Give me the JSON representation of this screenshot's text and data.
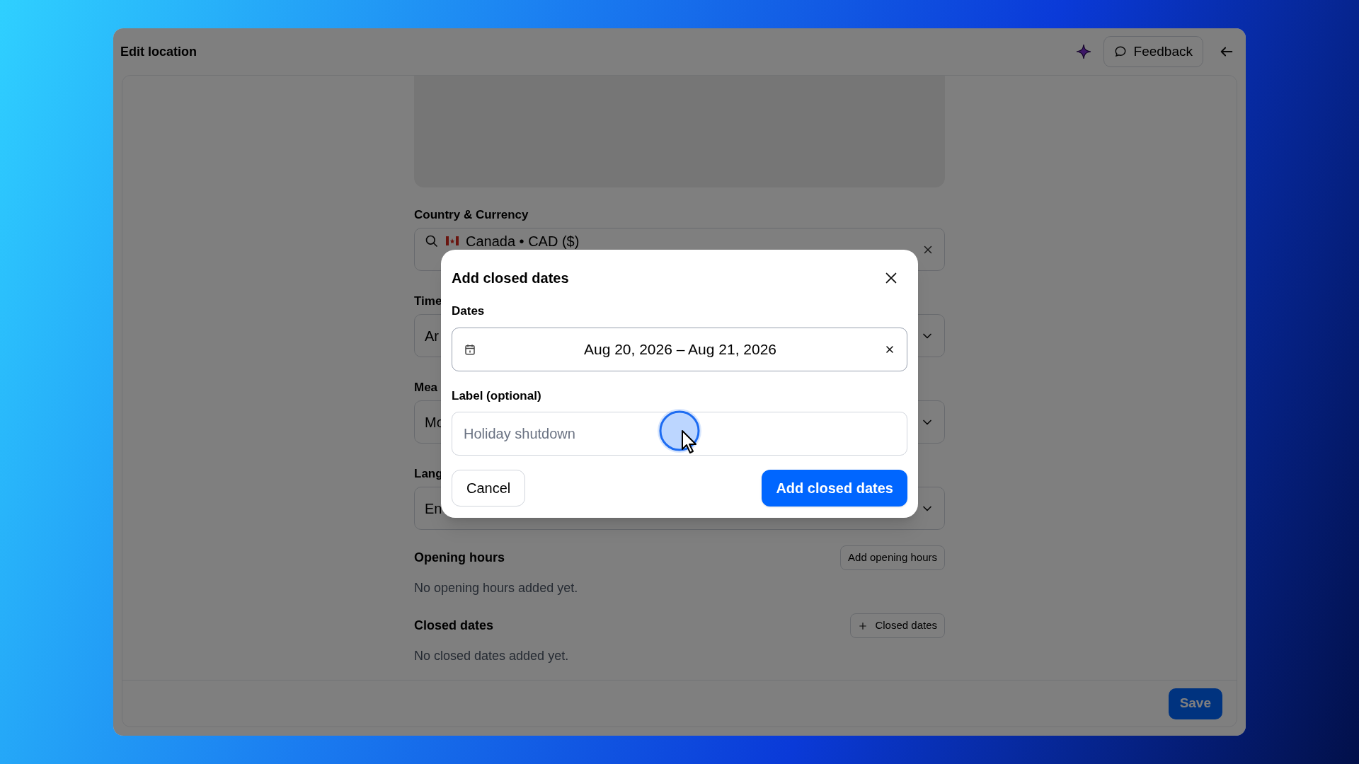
{
  "window": {
    "title": "Edit location",
    "feedback_button": "Feedback"
  },
  "form": {
    "fields": [
      {
        "kind": "search",
        "label": "Country & Currency",
        "value": "Canada • CAD ($)"
      },
      {
        "kind": "select",
        "label": "Time",
        "value": "Ar"
      },
      {
        "kind": "select",
        "label": "Mea",
        "value": "Mo"
      },
      {
        "kind": "select",
        "label": "Lang",
        "value": "En"
      }
    ],
    "sections": [
      {
        "kind": "plain",
        "title": "Opening hours",
        "button": "Add opening hours",
        "empty_text": "No opening hours added yet."
      },
      {
        "kind": "plus",
        "title": "Closed dates",
        "button": "Closed dates",
        "empty_text": "No closed dates added yet."
      }
    ]
  },
  "footer": {
    "save_button": "Save"
  },
  "dialog": {
    "title": "Add closed dates",
    "fields": [
      {
        "kind": "date_range",
        "label": "Dates",
        "value": "Aug 20, 2026 – Aug 21, 2026"
      },
      {
        "kind": "text",
        "label": "Label (optional)",
        "placeholder": "Holiday shutdown"
      }
    ],
    "cancel_button": "Cancel",
    "confirm_button": "Add closed dates"
  }
}
